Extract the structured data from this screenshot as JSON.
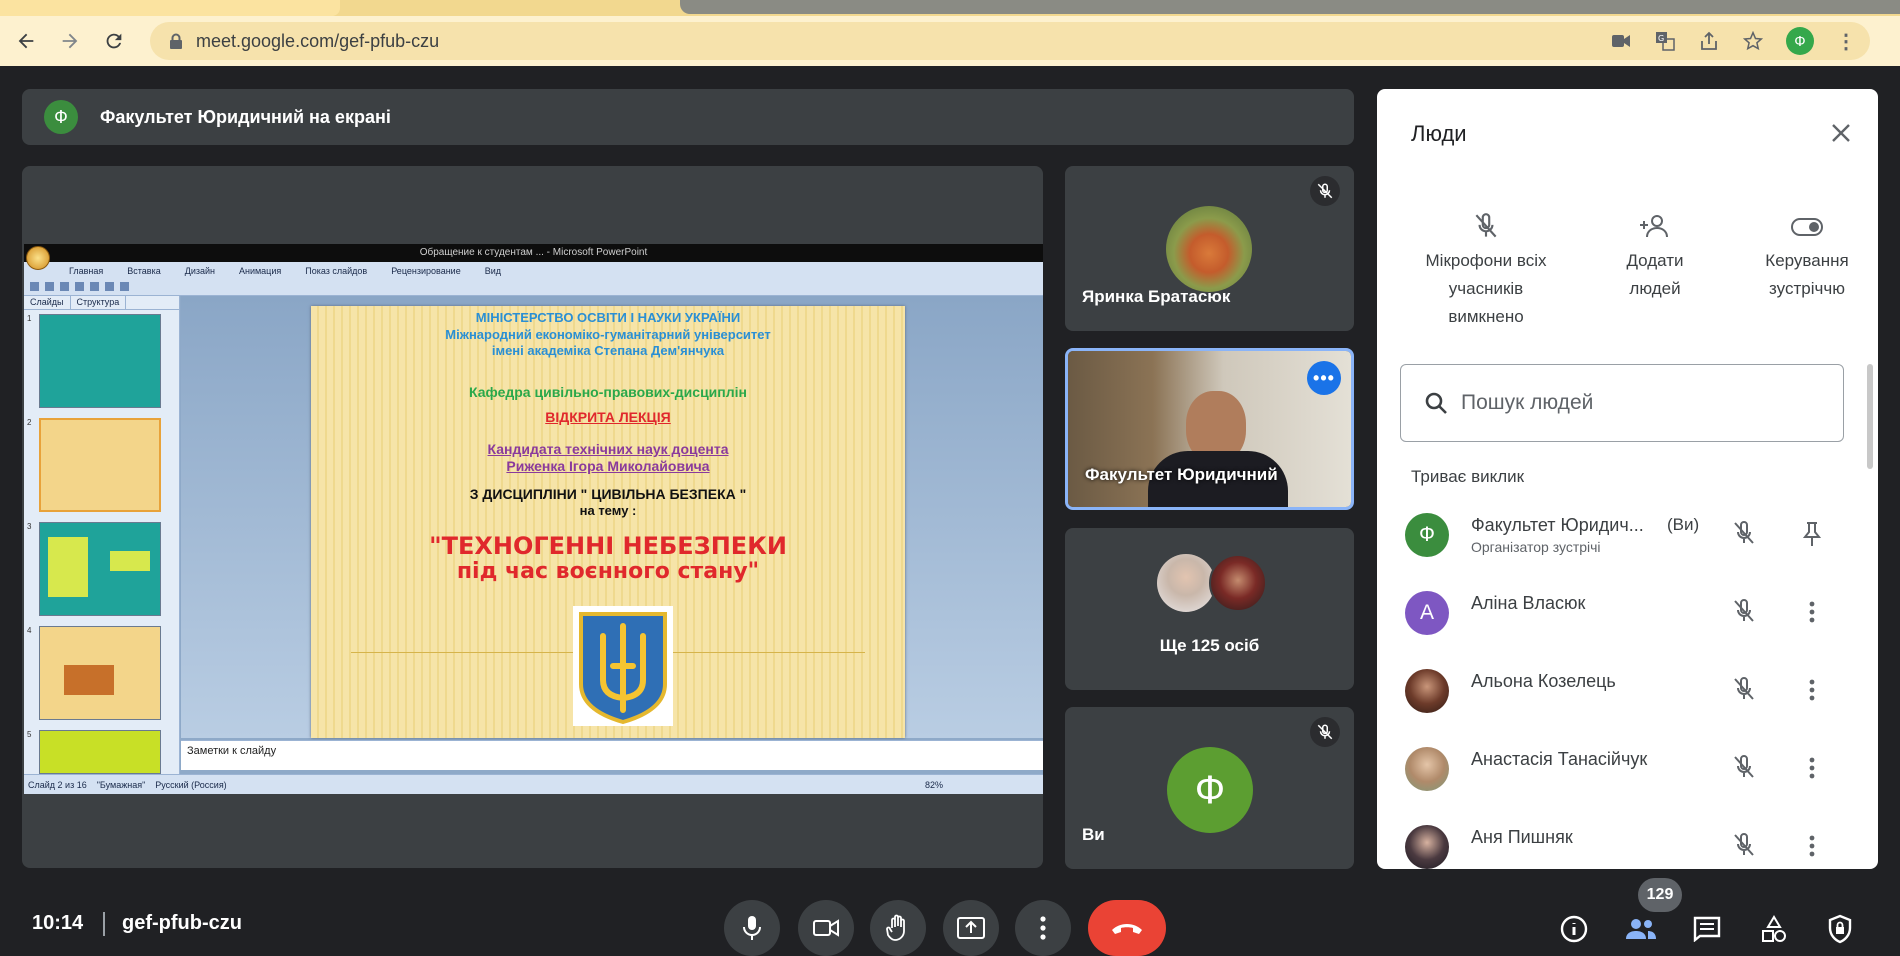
{
  "browser": {
    "url": "meet.google.com/gef-pfub-czu",
    "profile_initial": "Ф"
  },
  "banner": {
    "avatar_initial": "Ф",
    "text": "Факультет Юридичний на екрані"
  },
  "presentation": {
    "window_title": "Обращение к студентам ... - Microsoft PowerPoint",
    "ribbon_tabs": [
      "Главная",
      "Вставка",
      "Дизайн",
      "Анимация",
      "Показ слайдов",
      "Рецензирование",
      "Вид"
    ],
    "side_tabs": [
      "Слайды",
      "Структура"
    ],
    "slide_lines": [
      "МІНІСТЕРСТВО ОСВІТИ І НАУКИ УКРАЇНИ",
      "Міжнародний економіко-гуманітарний університет",
      "імені академіка  Степана Дем'янчука",
      "Кафедра цивільно-правових-дисциплін",
      "ВІДКРИТА ЛЕКЦІЯ",
      "Кандидата технічних наук доцента",
      "Риженка Ігора Миколайовича",
      "З ДИСЦИПЛІНИ \" ЦИВІЛЬНА БЕЗПЕКА  \"",
      "на тему  :",
      "\"ТЕХНОГЕННІ НЕБЕЗПЕКИ",
      "під час воєнного стану\""
    ],
    "notes_placeholder": "Заметки к слайду",
    "status_slide": "Слайд 2 из 16",
    "status_theme": "\"Бумажная\"",
    "status_lang": "Русский (Россия)",
    "status_zoom": "82%",
    "thumb_numbers": [
      "1",
      "2",
      "3",
      "4",
      "5"
    ]
  },
  "tiles": {
    "t1_name": "Яринка Братасюк",
    "t2_name": "Факультет Юридичний",
    "t3_name": "Ще 125 осіб",
    "t4_name": "Ви",
    "t4_initial": "Ф"
  },
  "panel": {
    "title": "Люди",
    "action1": [
      "Мікрофони всіх",
      "учасників",
      "вимкнено"
    ],
    "action2": [
      "Додати",
      "людей"
    ],
    "action3": [
      "Керування",
      "зустріччю"
    ],
    "search_placeholder": "Пошук людей",
    "section": "Триває виклик",
    "people": [
      {
        "initial": "Ф",
        "name": "Факультет Юридич...",
        "badge": "(Ви)",
        "sub": "Організатор зустрічі",
        "color": "#3b8d3e"
      },
      {
        "initial": "А",
        "name": "Аліна Власюк",
        "color": "#7e57c2"
      },
      {
        "initial": "",
        "name": "Альона Козелець",
        "color": "#6d3b2a"
      },
      {
        "initial": "",
        "name": "Анастасія Танасійчук",
        "color": "#b08a6a"
      },
      {
        "initial": "",
        "name": "Аня Пишняк",
        "color": "#2b2b33"
      }
    ]
  },
  "bottom": {
    "time": "10:14",
    "code": "gef-pfub-czu",
    "participants": "129"
  }
}
